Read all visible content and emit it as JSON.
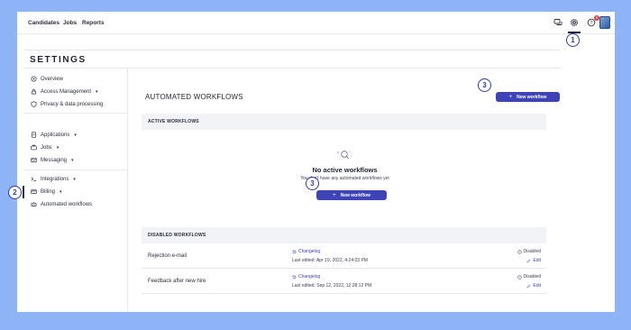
{
  "topnav": {
    "items": [
      {
        "label": "Candidates"
      },
      {
        "label": "Jobs"
      },
      {
        "label": "Reports"
      }
    ],
    "notification_count": "5",
    "icons": [
      "chat-icon",
      "gear-icon",
      "help-icon",
      "avatar"
    ]
  },
  "callouts": [
    "1",
    "2",
    "3",
    "3"
  ],
  "settings": {
    "title": "SETTINGS"
  },
  "sidebar": {
    "items": [
      {
        "label": "Overview",
        "icon": "home-icon",
        "chevron": false
      },
      {
        "label": "Access Management",
        "icon": "lock-icon",
        "chevron": true
      },
      {
        "label": "Privacy & data processing",
        "icon": "shield-icon",
        "chevron": false
      },
      {
        "label": "Applications",
        "icon": "document-icon",
        "chevron": true
      },
      {
        "label": "Jobs",
        "icon": "briefcase-icon",
        "chevron": true
      },
      {
        "label": "Messaging",
        "icon": "envelope-icon",
        "chevron": true
      },
      {
        "label": "Integrations",
        "icon": "terminal-icon",
        "chevron": true
      },
      {
        "label": "Billing",
        "icon": "credit-card-icon",
        "chevron": true
      },
      {
        "label": "Automated workflows",
        "icon": "workflow-icon",
        "chevron": false,
        "active": true
      }
    ]
  },
  "main": {
    "title": "AUTOMATED WORKFLOWS",
    "new_workflow_label": "New workflow",
    "active_section": "ACTIVE WORKFLOWS",
    "empty_title": "No active workflows",
    "empty_subtitle": "You don't have any automated workflows yet",
    "disabled_section": "DISABLED WORKFLOWS",
    "disabled_workflows": [
      {
        "name": "Rejection e-mail",
        "changelog": "Changelog",
        "edited": "Last edited: Apr 19, 2022, 4:24:03 PM",
        "status": "Disabled",
        "edit": "Edit"
      },
      {
        "name": "Feedback after new hire",
        "changelog": "Changelog",
        "edited": "Last edited: Sep 12, 2022, 12:28:12 PM",
        "status": "Disabled",
        "edit": "Edit"
      }
    ]
  },
  "colors": {
    "background": "#8fb3f7",
    "accent": "#3e43b8",
    "callout": "#2d3aa8",
    "badge": "#e53b3b"
  }
}
